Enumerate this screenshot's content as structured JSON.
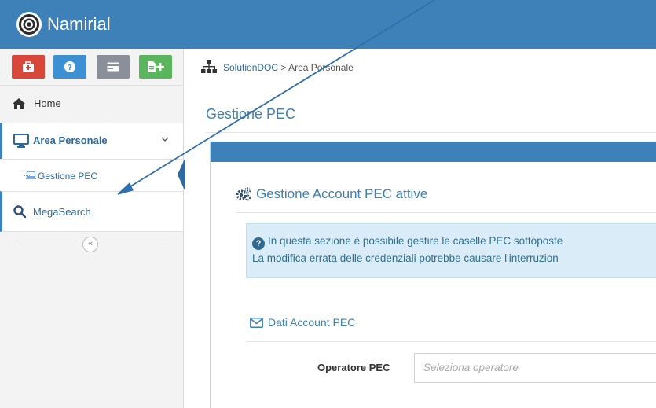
{
  "app": {
    "brand": "Namirial"
  },
  "quick_buttons": [
    {
      "name": "first-aid-icon",
      "color": "#d9463a"
    },
    {
      "name": "help-icon",
      "color": "#3d91d3"
    },
    {
      "name": "card-icon",
      "color": "#8a8f99"
    },
    {
      "name": "add-document-icon",
      "color": "#59b65c"
    }
  ],
  "sidebar": {
    "items": [
      {
        "label": "Home",
        "icon": "home-icon"
      },
      {
        "label": "Area Personale",
        "icon": "monitor-icon",
        "expanded": true
      },
      {
        "label": "Gestione PEC",
        "icon": "laptop-icon",
        "active": true
      },
      {
        "label": "MegaSearch",
        "icon": "search-icon"
      }
    ],
    "collapse_glyph": "«"
  },
  "breadcrumb": {
    "root": "SolutionDOC",
    "separator": ">",
    "current": "Area Personale"
  },
  "page": {
    "title": "Gestione PEC",
    "card_title": "Gestione Account PEC attive",
    "info_line1": "In questa sezione è possibile gestire le caselle PEC sottoposte",
    "info_line2": "La modifica errata delle credenziali potrebbe causare l'interruzion",
    "section_title": "Dati Account PEC",
    "form": {
      "operator_label": "Operatore PEC",
      "operator_placeholder": "Seleziona operatore"
    }
  },
  "colors": {
    "accent": "#3d81b8",
    "info_bg": "#d9ecf7",
    "annotation_arrow": "#2e6fb0"
  }
}
